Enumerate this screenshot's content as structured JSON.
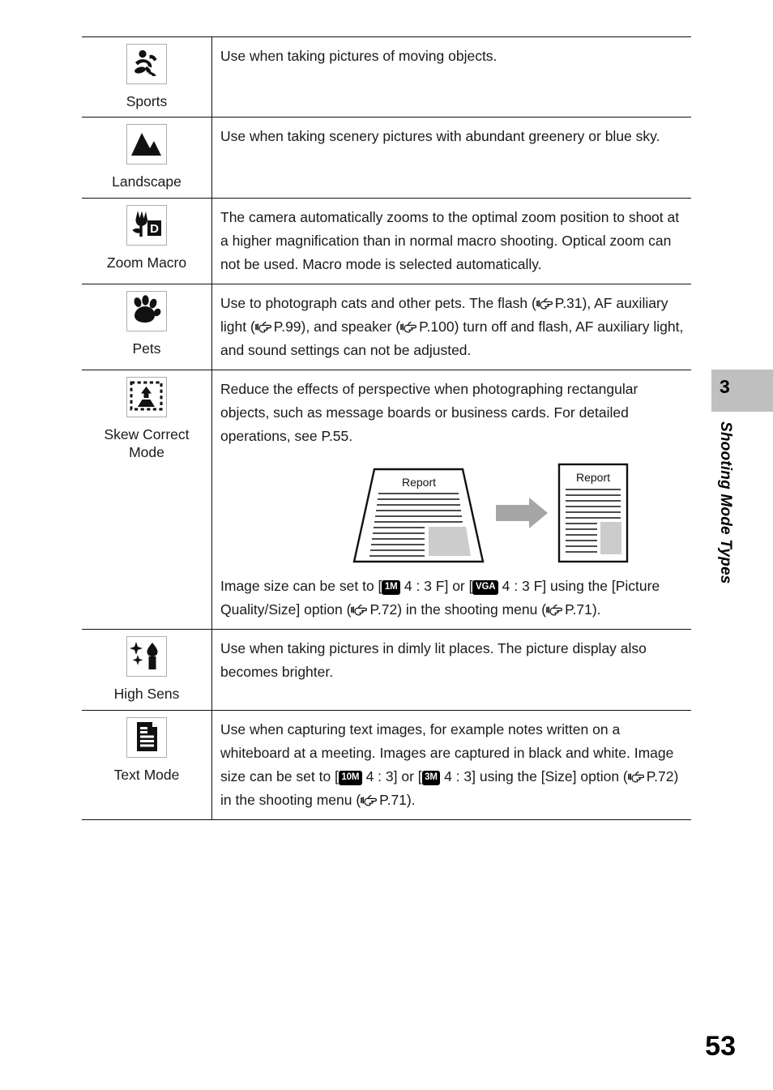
{
  "page": {
    "number": "53",
    "chapter_number": "3",
    "chapter_title": "Shooting Mode Types"
  },
  "table": {
    "rows": [
      {
        "icon": "sports-icon",
        "label": "Sports",
        "description_parts": [
          {
            "type": "text",
            "value": "Use when taking pictures of moving objects."
          }
        ]
      },
      {
        "icon": "landscape-icon",
        "label": "Landscape",
        "description_parts": [
          {
            "type": "text",
            "value": "Use when taking scenery pictures with abundant greenery or blue sky."
          }
        ]
      },
      {
        "icon": "zoom-macro-icon",
        "label": "Zoom Macro",
        "description_parts": [
          {
            "type": "text",
            "value": "The camera automatically zooms to the optimal zoom position to shoot at a higher magnification than in normal macro shooting. Optical zoom can not be used. Macro mode is selected automatically."
          }
        ]
      },
      {
        "icon": "pets-icon",
        "label": "Pets",
        "description_parts": [
          {
            "type": "text",
            "value": "Use to photograph cats and other pets. The flash ("
          },
          {
            "type": "handref",
            "value": "page-reference-icon"
          },
          {
            "type": "text",
            "value": "P.31), AF auxiliary light ("
          },
          {
            "type": "handref",
            "value": "page-reference-icon"
          },
          {
            "type": "text",
            "value": "P.99), and speaker ("
          },
          {
            "type": "handref",
            "value": "page-reference-icon"
          },
          {
            "type": "text",
            "value": "P.100) turn off and flash, AF auxiliary light, and sound settings can not be adjusted."
          }
        ]
      },
      {
        "icon": "skew-correct-icon",
        "label": "Skew Correct Mode",
        "label_line1": "Skew Correct",
        "label_line2": "Mode",
        "description_parts": [
          {
            "type": "text",
            "value": "Reduce the effects of perspective when photographing rectangular objects, such as message boards or business cards. For detailed operations, see P.55."
          }
        ],
        "figure": {
          "name": "skew-correction-illustration",
          "source_label": "Report",
          "result_label": "Report"
        },
        "description_parts_after": [
          {
            "type": "text",
            "value": "Image size can be set to ["
          },
          {
            "type": "badge",
            "value": "1M"
          },
          {
            "type": "text",
            "value": " 4 : 3 F] or ["
          },
          {
            "type": "badge",
            "value": "VGA"
          },
          {
            "type": "text",
            "value": " 4 : 3 F] using the [Picture Quality/Size] option ("
          },
          {
            "type": "handref",
            "value": "page-reference-icon"
          },
          {
            "type": "text",
            "value": "P.72) in the shooting menu ("
          },
          {
            "type": "handref",
            "value": "page-reference-icon"
          },
          {
            "type": "text",
            "value": "P.71)."
          }
        ]
      },
      {
        "icon": "high-sens-icon",
        "label": "High Sens",
        "description_parts": [
          {
            "type": "text",
            "value": "Use when taking pictures in dimly lit places. The picture display also becomes brighter."
          }
        ]
      },
      {
        "icon": "text-mode-icon",
        "label": "Text Mode",
        "description_parts": [
          {
            "type": "text",
            "value": "Use when capturing text images, for example notes written on a whiteboard at a meeting. Images are captured in black and white. Image size can be set to ["
          },
          {
            "type": "badge",
            "value": "10M"
          },
          {
            "type": "text",
            "value": " 4 : 3] or ["
          },
          {
            "type": "badge",
            "value": "3M"
          },
          {
            "type": "text",
            "value": " 4 : 3] using the [Size] option ("
          },
          {
            "type": "handref",
            "value": "page-reference-icon"
          },
          {
            "type": "text",
            "value": "P.72) in the shooting menu ("
          },
          {
            "type": "handref",
            "value": "page-reference-icon"
          },
          {
            "type": "text",
            "value": "P.71)."
          }
        ]
      }
    ]
  },
  "colors": {
    "tab_background": "#bfbfbf",
    "text": "#1a1a1a",
    "rule": "#111111",
    "figure_arrow": "#a6a6a6",
    "figure_block": "#cccccc"
  }
}
